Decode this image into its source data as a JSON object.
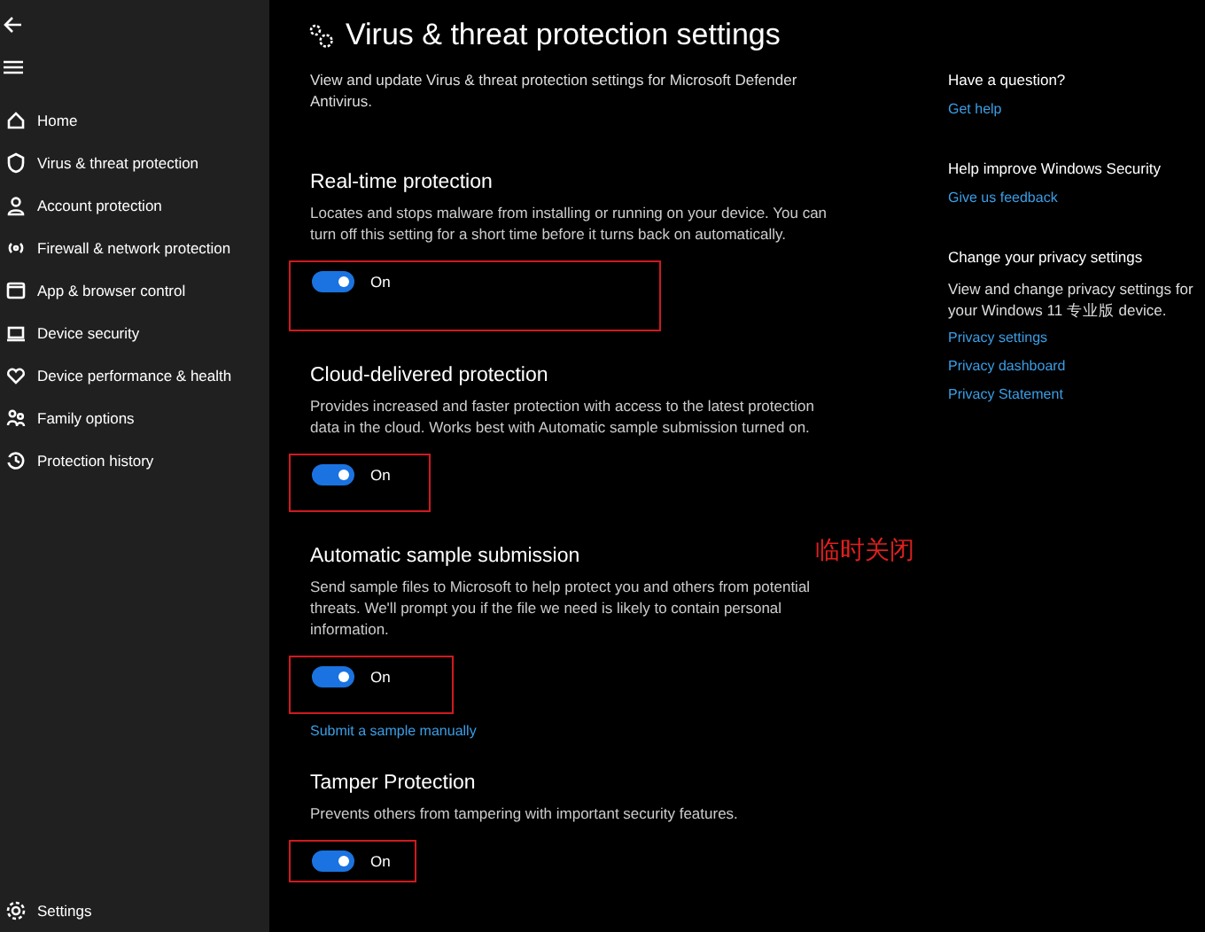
{
  "nav": {
    "items": [
      {
        "kind": "home",
        "label": "Home"
      },
      {
        "kind": "shield",
        "label": "Virus & threat protection"
      },
      {
        "kind": "person",
        "label": "Account protection"
      },
      {
        "kind": "wifi",
        "label": "Firewall & network protection"
      },
      {
        "kind": "window",
        "label": "App & browser control"
      },
      {
        "kind": "laptop",
        "label": "Device security"
      },
      {
        "kind": "heart",
        "label": "Device performance & health"
      },
      {
        "kind": "family",
        "label": "Family options"
      },
      {
        "kind": "history",
        "label": "Protection history"
      }
    ],
    "settings": "Settings"
  },
  "page": {
    "title": "Virus & threat protection settings",
    "subtitle": "View and update Virus & threat protection settings for Microsoft Defender Antivirus."
  },
  "sections": [
    {
      "title": "Real-time protection",
      "description": "Locates and stops malware from installing or running on your device. You can turn off this setting for a short time before it turns back on automatically.",
      "toggle": {
        "on": true,
        "label": "On"
      },
      "highlighted": true
    },
    {
      "title": "Cloud-delivered protection",
      "description": "Provides increased and faster protection with access to the latest protection data in the cloud. Works best with Automatic sample submission turned on.",
      "toggle": {
        "on": true,
        "label": "On"
      },
      "highlighted": true
    },
    {
      "title": "Automatic sample submission",
      "description": "Send sample files to Microsoft to help protect you and others from potential threats. We'll prompt you if the file we need is likely to contain personal information.",
      "toggle": {
        "on": true,
        "label": "On"
      },
      "highlighted": true,
      "link": "Submit a sample manually"
    },
    {
      "title": "Tamper Protection",
      "description": "Prevents others from tampering with important security features.",
      "toggle": {
        "on": true,
        "label": "On"
      },
      "highlighted": true
    }
  ],
  "annotation": "临时关闭",
  "aside": [
    {
      "heading": "Have a question?",
      "links": [
        "Get help"
      ]
    },
    {
      "heading": "Help improve Windows Security",
      "links": [
        "Give us feedback"
      ]
    },
    {
      "heading": "Change your privacy settings",
      "text": "View and change privacy settings for your Windows 11 专业版 device.",
      "links": [
        "Privacy settings",
        "Privacy dashboard",
        "Privacy Statement"
      ]
    }
  ]
}
